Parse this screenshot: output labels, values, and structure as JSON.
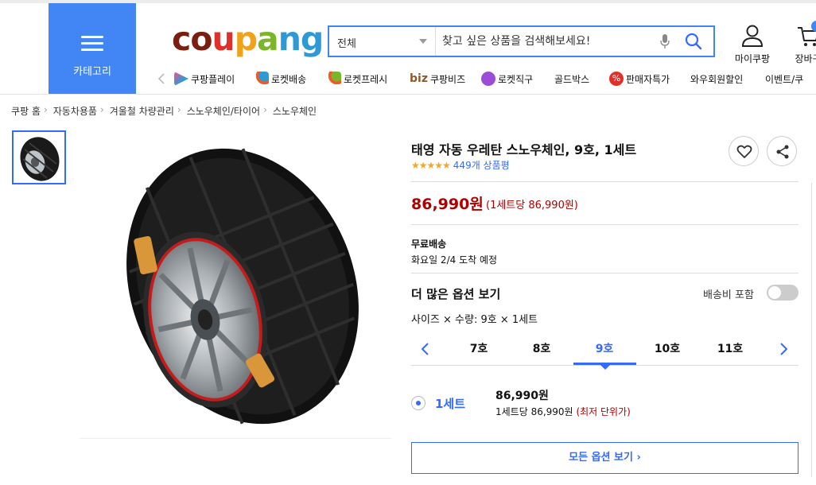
{
  "header": {
    "category_label": "카테고리",
    "logo_letters": [
      "c",
      "o",
      "u",
      "p",
      "a",
      "n",
      "g"
    ],
    "search": {
      "scope": "전체",
      "placeholder": "찾고 싶은 상품을 검색해보세요!"
    },
    "my_coupang": "마이쿠팡",
    "cart": "장바구",
    "quick_nav": [
      {
        "label": "쿠팡플레이",
        "icon": "coupang-play-icon"
      },
      {
        "label": "로켓배송",
        "icon": "rocket-icon"
      },
      {
        "label": "로켓프레시",
        "icon": "rocket-fresh-icon"
      },
      {
        "label": "쿠팡비즈",
        "prefix": "biz",
        "icon": "biz-icon"
      },
      {
        "label": "로켓직구",
        "icon": "rocket-global-icon"
      },
      {
        "label": "골드박스",
        "icon": ""
      },
      {
        "label": "판매자특가",
        "icon": "percent-icon"
      },
      {
        "label": "와우회원할인",
        "icon": ""
      },
      {
        "label": "이벤트/쿠",
        "icon": ""
      }
    ]
  },
  "breadcrumb": [
    "쿠팡 홈",
    "자동차용품",
    "겨울철 차량관리",
    "스노우체인/타이어",
    "스노우체인"
  ],
  "product": {
    "title": "태영 자동 우레탄 스노우체인, 9호, 1세트",
    "stars": "★★★★★",
    "review_count": "449개 상품평",
    "price": "86,990원",
    "unit_price": "(1세트당 86,990원)",
    "shipping_title": "무료배송",
    "shipping_date": "화요일 2/4 도착 예정",
    "more_options": "더 많은 옵션 보기",
    "shipping_toggle_label": "배송비 포함",
    "shipping_toggle_on": false,
    "option_summary": "사이즈 × 수량: 9호 × 1세트",
    "sizes": [
      "7호",
      "8호",
      "9호",
      "10호",
      "11호"
    ],
    "selected_size": "9호",
    "option": {
      "qty_label": "1세트",
      "price": "86,990원",
      "unit": "1세트당 86,990원",
      "lowest": "(최저 단위가)"
    },
    "all_options_button": "모든 옵션 보기 ›"
  },
  "colors": {
    "brand_blue": "#346aff",
    "category_blue": "#4285f4",
    "price_red": "#ae0000",
    "star": "#f5a623"
  }
}
